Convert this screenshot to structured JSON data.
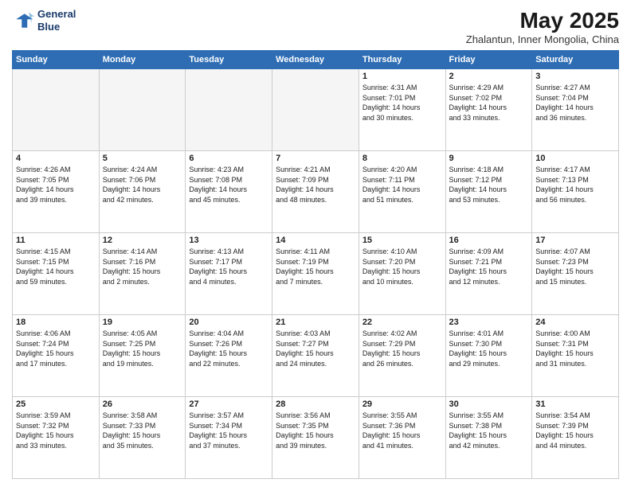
{
  "logo": {
    "line1": "General",
    "line2": "Blue"
  },
  "title": "May 2025",
  "subtitle": "Zhalantun, Inner Mongolia, China",
  "header_days": [
    "Sunday",
    "Monday",
    "Tuesday",
    "Wednesday",
    "Thursday",
    "Friday",
    "Saturday"
  ],
  "weeks": [
    [
      {
        "num": "",
        "info": ""
      },
      {
        "num": "",
        "info": ""
      },
      {
        "num": "",
        "info": ""
      },
      {
        "num": "",
        "info": ""
      },
      {
        "num": "1",
        "info": "Sunrise: 4:31 AM\nSunset: 7:01 PM\nDaylight: 14 hours\nand 30 minutes."
      },
      {
        "num": "2",
        "info": "Sunrise: 4:29 AM\nSunset: 7:02 PM\nDaylight: 14 hours\nand 33 minutes."
      },
      {
        "num": "3",
        "info": "Sunrise: 4:27 AM\nSunset: 7:04 PM\nDaylight: 14 hours\nand 36 minutes."
      }
    ],
    [
      {
        "num": "4",
        "info": "Sunrise: 4:26 AM\nSunset: 7:05 PM\nDaylight: 14 hours\nand 39 minutes."
      },
      {
        "num": "5",
        "info": "Sunrise: 4:24 AM\nSunset: 7:06 PM\nDaylight: 14 hours\nand 42 minutes."
      },
      {
        "num": "6",
        "info": "Sunrise: 4:23 AM\nSunset: 7:08 PM\nDaylight: 14 hours\nand 45 minutes."
      },
      {
        "num": "7",
        "info": "Sunrise: 4:21 AM\nSunset: 7:09 PM\nDaylight: 14 hours\nand 48 minutes."
      },
      {
        "num": "8",
        "info": "Sunrise: 4:20 AM\nSunset: 7:11 PM\nDaylight: 14 hours\nand 51 minutes."
      },
      {
        "num": "9",
        "info": "Sunrise: 4:18 AM\nSunset: 7:12 PM\nDaylight: 14 hours\nand 53 minutes."
      },
      {
        "num": "10",
        "info": "Sunrise: 4:17 AM\nSunset: 7:13 PM\nDaylight: 14 hours\nand 56 minutes."
      }
    ],
    [
      {
        "num": "11",
        "info": "Sunrise: 4:15 AM\nSunset: 7:15 PM\nDaylight: 14 hours\nand 59 minutes."
      },
      {
        "num": "12",
        "info": "Sunrise: 4:14 AM\nSunset: 7:16 PM\nDaylight: 15 hours\nand 2 minutes."
      },
      {
        "num": "13",
        "info": "Sunrise: 4:13 AM\nSunset: 7:17 PM\nDaylight: 15 hours\nand 4 minutes."
      },
      {
        "num": "14",
        "info": "Sunrise: 4:11 AM\nSunset: 7:19 PM\nDaylight: 15 hours\nand 7 minutes."
      },
      {
        "num": "15",
        "info": "Sunrise: 4:10 AM\nSunset: 7:20 PM\nDaylight: 15 hours\nand 10 minutes."
      },
      {
        "num": "16",
        "info": "Sunrise: 4:09 AM\nSunset: 7:21 PM\nDaylight: 15 hours\nand 12 minutes."
      },
      {
        "num": "17",
        "info": "Sunrise: 4:07 AM\nSunset: 7:23 PM\nDaylight: 15 hours\nand 15 minutes."
      }
    ],
    [
      {
        "num": "18",
        "info": "Sunrise: 4:06 AM\nSunset: 7:24 PM\nDaylight: 15 hours\nand 17 minutes."
      },
      {
        "num": "19",
        "info": "Sunrise: 4:05 AM\nSunset: 7:25 PM\nDaylight: 15 hours\nand 19 minutes."
      },
      {
        "num": "20",
        "info": "Sunrise: 4:04 AM\nSunset: 7:26 PM\nDaylight: 15 hours\nand 22 minutes."
      },
      {
        "num": "21",
        "info": "Sunrise: 4:03 AM\nSunset: 7:27 PM\nDaylight: 15 hours\nand 24 minutes."
      },
      {
        "num": "22",
        "info": "Sunrise: 4:02 AM\nSunset: 7:29 PM\nDaylight: 15 hours\nand 26 minutes."
      },
      {
        "num": "23",
        "info": "Sunrise: 4:01 AM\nSunset: 7:30 PM\nDaylight: 15 hours\nand 29 minutes."
      },
      {
        "num": "24",
        "info": "Sunrise: 4:00 AM\nSunset: 7:31 PM\nDaylight: 15 hours\nand 31 minutes."
      }
    ],
    [
      {
        "num": "25",
        "info": "Sunrise: 3:59 AM\nSunset: 7:32 PM\nDaylight: 15 hours\nand 33 minutes."
      },
      {
        "num": "26",
        "info": "Sunrise: 3:58 AM\nSunset: 7:33 PM\nDaylight: 15 hours\nand 35 minutes."
      },
      {
        "num": "27",
        "info": "Sunrise: 3:57 AM\nSunset: 7:34 PM\nDaylight: 15 hours\nand 37 minutes."
      },
      {
        "num": "28",
        "info": "Sunrise: 3:56 AM\nSunset: 7:35 PM\nDaylight: 15 hours\nand 39 minutes."
      },
      {
        "num": "29",
        "info": "Sunrise: 3:55 AM\nSunset: 7:36 PM\nDaylight: 15 hours\nand 41 minutes."
      },
      {
        "num": "30",
        "info": "Sunrise: 3:55 AM\nSunset: 7:38 PM\nDaylight: 15 hours\nand 42 minutes."
      },
      {
        "num": "31",
        "info": "Sunrise: 3:54 AM\nSunset: 7:39 PM\nDaylight: 15 hours\nand 44 minutes."
      }
    ]
  ]
}
